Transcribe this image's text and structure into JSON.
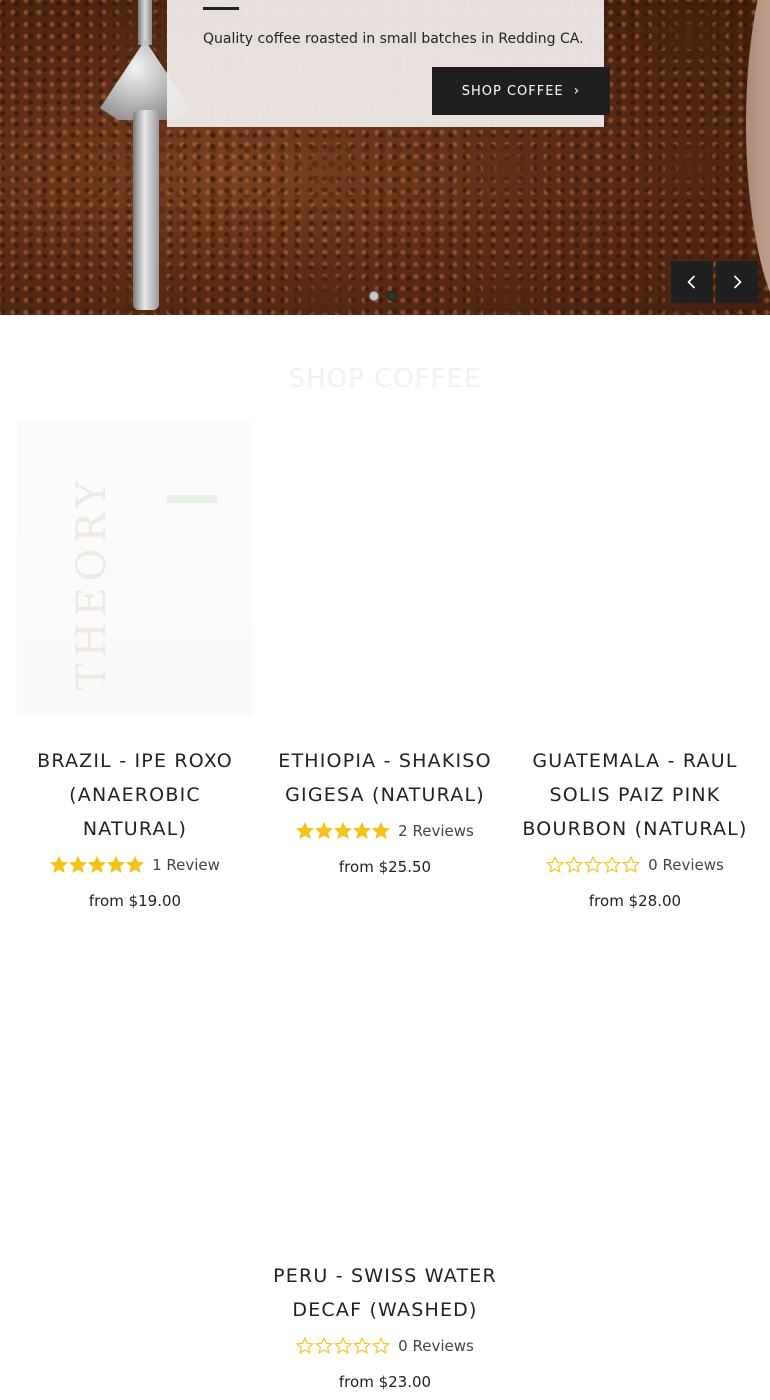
{
  "hero": {
    "tagline": "Quality coffee roasted in small batches in Redding CA.",
    "button_label": "SHOP COFFEE",
    "slides": [
      {
        "active": true
      },
      {
        "active": false
      }
    ]
  },
  "section": {
    "title": "SHOP COFFEE"
  },
  "colors": {
    "accent": "#f3c31a",
    "button_bg": "#1f1f1f",
    "hero_card": "#f2eeec"
  },
  "bag_brand_text": "THEORY",
  "products": [
    {
      "name": "BRAZIL - IPE ROXO (ANAEROBIC NATURAL)",
      "rating": 5,
      "reviews": "1 Review",
      "price": "from $19.00"
    },
    {
      "name": "ETHIOPIA - SHAKISO GIGESA (NATURAL)",
      "rating": 5,
      "reviews": "2 Reviews",
      "price": "from $25.50"
    },
    {
      "name": "GUATEMALA - RAUL SOLIS PAIZ PINK BOURBON (NATURAL)",
      "rating": 0,
      "reviews": "0 Reviews",
      "price": "from $28.00"
    },
    {
      "name": "PERU - SWISS WATER DECAF (WASHED)",
      "rating": 0,
      "reviews": "0 Reviews",
      "price": "from $23.00"
    }
  ]
}
